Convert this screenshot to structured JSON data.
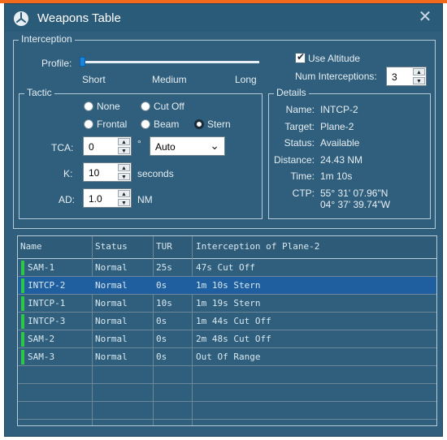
{
  "window": {
    "title": "Weapons Table",
    "icon": "radar-icon",
    "close_icon": "close-icon"
  },
  "interception": {
    "group_label": "Interception",
    "profile_label": "Profile:",
    "profile_stops": [
      "Short",
      "Medium",
      "Long"
    ],
    "profile_level": 0,
    "use_altitude_label": "Use Altitude",
    "use_altitude_checked": true,
    "num_interceptions_label": "Num Interceptions:",
    "num_interceptions_value": "3"
  },
  "tactic": {
    "group_label": "Tactic",
    "options": {
      "none": "None",
      "cutoff": "Cut Off",
      "frontal": "Frontal",
      "beam": "Beam",
      "stern": "Stern"
    },
    "selected": "Stern",
    "tca_label": "TCA:",
    "tca_value": "0",
    "tca_unit": "°",
    "tca_mode": "Auto",
    "k_label": "K:",
    "k_value": "10",
    "k_unit": "seconds",
    "ad_label": "AD:",
    "ad_value": "1.0",
    "ad_unit": "NM"
  },
  "details": {
    "group_label": "Details",
    "rows": [
      {
        "label": "Name:",
        "value": "INTCP-2"
      },
      {
        "label": "Target:",
        "value": "Plane-2"
      },
      {
        "label": "Status:",
        "value": "Available"
      },
      {
        "label": "Distance:",
        "value": "24.43 NM"
      },
      {
        "label": "Time:",
        "value": "1m 10s"
      }
    ],
    "ctp_label": "CTP:",
    "ctp_lines": [
      "55° 31' 07.96\"N",
      "04° 37' 39.74\"W"
    ]
  },
  "table": {
    "headers": [
      "Name",
      "Status",
      "TUR",
      "Interception of Plane-2"
    ],
    "rows": [
      [
        "SAM-1",
        "Normal",
        "25s",
        "47s Cut Off"
      ],
      [
        "INTCP-2",
        "Normal",
        "0s",
        "1m 10s Stern"
      ],
      [
        "INTCP-1",
        "Normal",
        "10s",
        "1m 19s Stern"
      ],
      [
        "INTCP-3",
        "Normal",
        "0s",
        "1m 44s Cut Off"
      ],
      [
        "SAM-2",
        "Normal",
        "0s",
        "2m 48s Cut Off"
      ],
      [
        "SAM-3",
        "Normal",
        "0s",
        "Out Of Range"
      ]
    ],
    "selected_row": 1,
    "status_color": "#2cc64a",
    "accent": "#f26a1b"
  }
}
